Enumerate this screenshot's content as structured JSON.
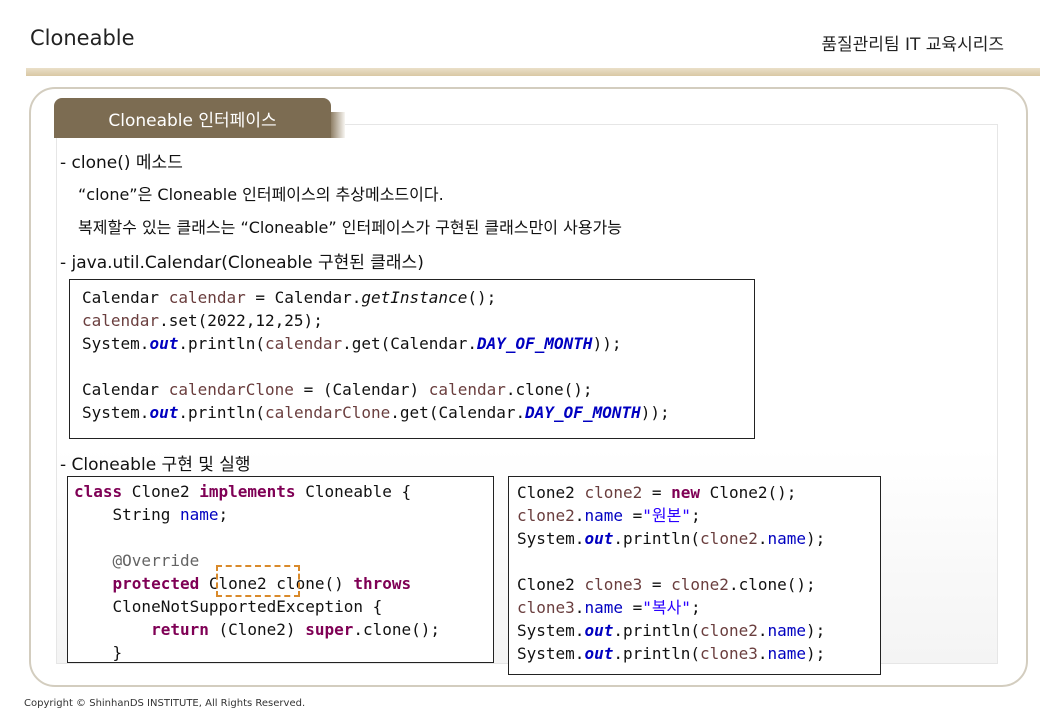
{
  "header": {
    "title": "Cloneable",
    "series": "품질관리팀 IT 교육시리즈"
  },
  "tab_label": "Cloneable 인터페이스",
  "bullets": {
    "b1": "- clone() 메소드",
    "b1_sub1": "“clone”은 Cloneable 인터페이스의 추상메소드이다.",
    "b1_sub2": "복제할수 있는 클래스는 “Cloneable” 인터페이스가 구현된 클래스만이 사용가능",
    "b2": "- java.util.Calendar(Cloneable 구현된 클래스)",
    "b3": "- Cloneable 구현 및 실행"
  },
  "code_calendar": [
    [
      {
        "t": "Calendar ",
        "c": ""
      },
      {
        "t": "calendar",
        "c": "var"
      },
      {
        "t": " = Calendar.",
        "c": ""
      },
      {
        "t": "getInstance",
        "c": "mth"
      },
      {
        "t": "();",
        "c": ""
      }
    ],
    [
      {
        "t": "calendar",
        "c": "var"
      },
      {
        "t": ".set(2022,12,25);",
        "c": ""
      }
    ],
    [
      {
        "t": "System.",
        "c": ""
      },
      {
        "t": "out",
        "c": "sfld"
      },
      {
        "t": ".println(",
        "c": ""
      },
      {
        "t": "calendar",
        "c": "var"
      },
      {
        "t": ".get(Calendar.",
        "c": ""
      },
      {
        "t": "DAY_OF_MONTH",
        "c": "sfld"
      },
      {
        "t": "));",
        "c": ""
      }
    ],
    [
      {
        "t": "",
        "c": ""
      }
    ],
    [
      {
        "t": "Calendar ",
        "c": ""
      },
      {
        "t": "calendarClone",
        "c": "var"
      },
      {
        "t": " = (Calendar) ",
        "c": ""
      },
      {
        "t": "calendar",
        "c": "var"
      },
      {
        "t": ".clone();",
        "c": ""
      }
    ],
    [
      {
        "t": "System.",
        "c": ""
      },
      {
        "t": "out",
        "c": "sfld"
      },
      {
        "t": ".println(",
        "c": ""
      },
      {
        "t": "calendarClone",
        "c": "var"
      },
      {
        "t": ".get(Calendar.",
        "c": ""
      },
      {
        "t": "DAY_OF_MONTH",
        "c": "sfld"
      },
      {
        "t": "));",
        "c": ""
      }
    ]
  ],
  "code_class": [
    [
      {
        "t": "class",
        "c": "kw"
      },
      {
        "t": " Clone2 ",
        "c": ""
      },
      {
        "t": "implements",
        "c": "kw"
      },
      {
        "t": " Cloneable {",
        "c": ""
      }
    ],
    [
      {
        "t": "    String ",
        "c": ""
      },
      {
        "t": "name",
        "c": "fld"
      },
      {
        "t": ";",
        "c": ""
      }
    ],
    [
      {
        "t": "",
        "c": ""
      }
    ],
    [
      {
        "t": "    ",
        "c": ""
      },
      {
        "t": "@Override",
        "c": "ann"
      }
    ],
    [
      {
        "t": "    ",
        "c": ""
      },
      {
        "t": "protected",
        "c": "kw"
      },
      {
        "t": " Clone2 clone() ",
        "c": ""
      },
      {
        "t": "throws",
        "c": "kw"
      }
    ],
    [
      {
        "t": "    CloneNotSupportedException {",
        "c": ""
      }
    ],
    [
      {
        "t": "        ",
        "c": ""
      },
      {
        "t": "return",
        "c": "kw"
      },
      {
        "t": " (Clone2) ",
        "c": ""
      },
      {
        "t": "super",
        "c": "kw"
      },
      {
        "t": ".clone();",
        "c": ""
      }
    ],
    [
      {
        "t": "    }",
        "c": ""
      }
    ]
  ],
  "code_run": [
    [
      {
        "t": "Clone2 ",
        "c": ""
      },
      {
        "t": "clone2",
        "c": "var"
      },
      {
        "t": " = ",
        "c": ""
      },
      {
        "t": "new",
        "c": "kw"
      },
      {
        "t": " Clone2();",
        "c": ""
      }
    ],
    [
      {
        "t": "clone2",
        "c": "var"
      },
      {
        "t": ".",
        "c": ""
      },
      {
        "t": "name",
        "c": "fld"
      },
      {
        "t": " =",
        "c": ""
      },
      {
        "t": "\"원본\"",
        "c": "str"
      },
      {
        "t": ";",
        "c": ""
      }
    ],
    [
      {
        "t": "System.",
        "c": ""
      },
      {
        "t": "out",
        "c": "sfld"
      },
      {
        "t": ".println(",
        "c": ""
      },
      {
        "t": "clone2",
        "c": "var"
      },
      {
        "t": ".",
        "c": ""
      },
      {
        "t": "name",
        "c": "fld"
      },
      {
        "t": ");",
        "c": ""
      }
    ],
    [
      {
        "t": "",
        "c": ""
      }
    ],
    [
      {
        "t": "Clone2 ",
        "c": ""
      },
      {
        "t": "clone3",
        "c": "var"
      },
      {
        "t": " = ",
        "c": ""
      },
      {
        "t": "clone2",
        "c": "var"
      },
      {
        "t": ".clone();",
        "c": ""
      }
    ],
    [
      {
        "t": "clone3",
        "c": "var"
      },
      {
        "t": ".",
        "c": ""
      },
      {
        "t": "name",
        "c": "fld"
      },
      {
        "t": " =",
        "c": ""
      },
      {
        "t": "\"복사\"",
        "c": "str"
      },
      {
        "t": ";",
        "c": ""
      }
    ],
    [
      {
        "t": "System.",
        "c": ""
      },
      {
        "t": "out",
        "c": "sfld"
      },
      {
        "t": ".println(",
        "c": ""
      },
      {
        "t": "clone2",
        "c": "var"
      },
      {
        "t": ".",
        "c": ""
      },
      {
        "t": "name",
        "c": "fld"
      },
      {
        "t": ");",
        "c": ""
      }
    ],
    [
      {
        "t": "System.",
        "c": ""
      },
      {
        "t": "out",
        "c": "sfld"
      },
      {
        "t": ".println(",
        "c": ""
      },
      {
        "t": "clone3",
        "c": "var"
      },
      {
        "t": ".",
        "c": ""
      },
      {
        "t": "name",
        "c": "fld"
      },
      {
        "t": ");",
        "c": ""
      }
    ]
  ],
  "footer": "Copyright © ShinhanDS INSTITUTE, All Rights Reserved."
}
